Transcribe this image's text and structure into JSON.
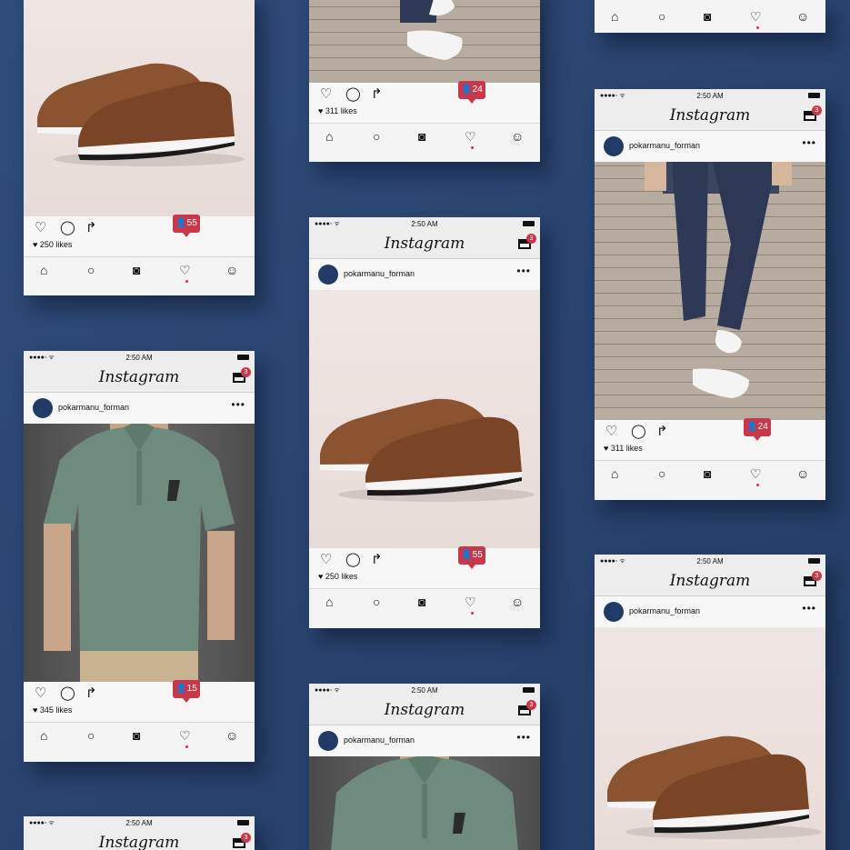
{
  "app": {
    "status_time": "2:50 AM",
    "title": "Instagram",
    "inbox_count": "3",
    "username": "pokarmanu_forman"
  },
  "posts": {
    "shoe": {
      "likes": "250 likes",
      "notifications": "55",
      "subject": "Brown leather sneakers"
    },
    "jeans": {
      "likes": "311 likes",
      "notifications": "24",
      "subject": "Jeans and white sneakers"
    },
    "polo": {
      "likes": "345 likes",
      "notifications": "15",
      "subject": "Green polo shirt"
    }
  },
  "icons": {
    "like": "heart-icon",
    "comment": "comment-icon",
    "share": "share-icon",
    "home": "home-icon",
    "search": "search-icon",
    "camera": "camera-icon",
    "activity": "heart-icon",
    "profile": "profile-icon",
    "inbox": "inbox-icon"
  },
  "colors": {
    "background": "#2b4570",
    "badge": "#c9374a",
    "card": "#f4f4f4"
  }
}
